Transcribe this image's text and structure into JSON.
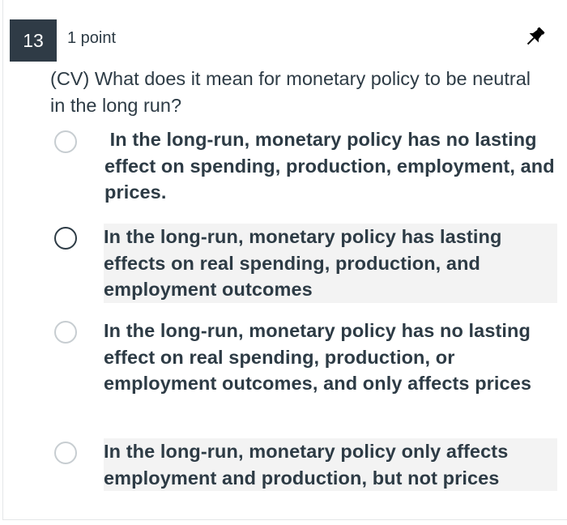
{
  "question": {
    "number": "13",
    "points": "1 point",
    "prompt": "(CV) What does it mean for monetary policy to be neutral in the long run?"
  },
  "answers": [
    {
      "text": " In the long-run, monetary policy has no lasting effect on spending, production, employment, and prices.",
      "selected": false
    },
    {
      "text": "In the long-run, monetary policy has lasting effects on real spending, production, and employment outcomes",
      "selected": false
    },
    {
      "text": "In the long-run, monetary policy has no lasting effect on real spending, production, or employment outcomes, and only affects prices",
      "selected": false
    },
    {
      "text": "In the long-run, monetary policy only affects employment and production, but not prices",
      "selected": false
    }
  ],
  "colors": {
    "text": "#2d3b45",
    "number_badge": "#2f3b46",
    "radio_border": "#c7cdd1"
  },
  "icons": {
    "pin": "pushpin-icon"
  }
}
